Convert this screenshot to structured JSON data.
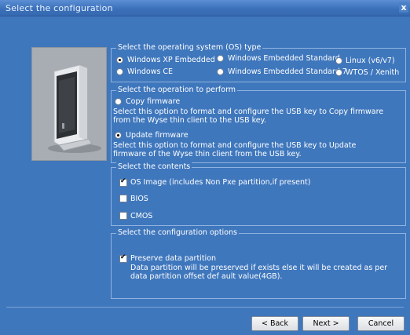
{
  "window": {
    "title": "Select the configuration",
    "close_label": "x"
  },
  "os_group": {
    "title": "Select the operating system (OS) type",
    "options": [
      {
        "label": "Windows XP Embedded",
        "selected": true
      },
      {
        "label": "Windows Embedded Standard",
        "selected": false
      },
      {
        "label": "Linux (v6/v7)",
        "selected": false
      },
      {
        "label": "Windows CE",
        "selected": false
      },
      {
        "label": "Windows Embedded Standard 7",
        "selected": false
      },
      {
        "label": "WTOS / Xenith",
        "selected": false
      }
    ]
  },
  "operation_group": {
    "title": "Select the operation to perform",
    "copy_label": "Copy firmware",
    "copy_desc": "Select this option to format and configure the USB key to Copy firmware from the Wyse thin client to the USB key.",
    "update_label": "Update firmware",
    "update_desc": "Select this option to format and configure the USB key to Update firmware of the Wyse thin client from the USB key.",
    "selected": "update"
  },
  "contents_group": {
    "title": "Select the contents",
    "items": [
      {
        "label": "OS Image (includes Non Pxe partition,if present)",
        "checked": true
      },
      {
        "label": "BIOS",
        "checked": false
      },
      {
        "label": "CMOS",
        "checked": false
      }
    ]
  },
  "config_group": {
    "title": "Select the configuration options",
    "preserve_label": "Preserve data partition",
    "preserve_checked": true,
    "preserve_desc": "Data partition will be preserved if exists else it will be created as per data partition offset def ault value(4GB)."
  },
  "buttons": {
    "back": "< Back",
    "next": "Next >",
    "cancel": "Cancel"
  },
  "colors": {
    "background": "#3f77bd",
    "title_bar": "#3c72bb",
    "group_border": "#8fb3de"
  }
}
